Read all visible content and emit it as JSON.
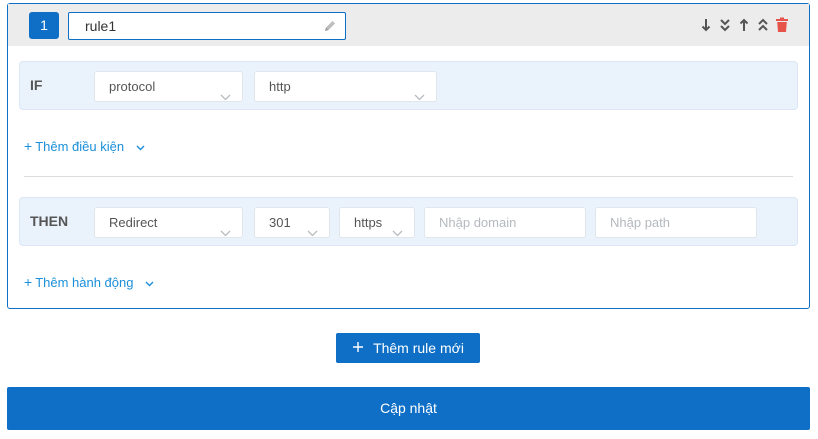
{
  "rule": {
    "index": "1",
    "name": "rule1",
    "tools": [
      "arrow-down-icon",
      "double-chevron-down-icon",
      "arrow-up-icon",
      "double-chevron-up-icon",
      "trash-icon"
    ]
  },
  "condition": {
    "label": "IF",
    "field": "protocol",
    "value": "http",
    "add_label": "Thêm điều kiện"
  },
  "action": {
    "label": "THEN",
    "type": "Redirect",
    "code": "301",
    "scheme": "https",
    "domain_placeholder": "Nhập domain",
    "path_placeholder": "Nhập path",
    "add_label": "Thêm hành động"
  },
  "buttons": {
    "add_rule": "Thêm rule mới",
    "update": "Cập nhật"
  },
  "colors": {
    "primary": "#0f6fc6",
    "link": "#1b8fd8",
    "danger": "#e5534b",
    "block_bg": "#eaf2fb"
  }
}
